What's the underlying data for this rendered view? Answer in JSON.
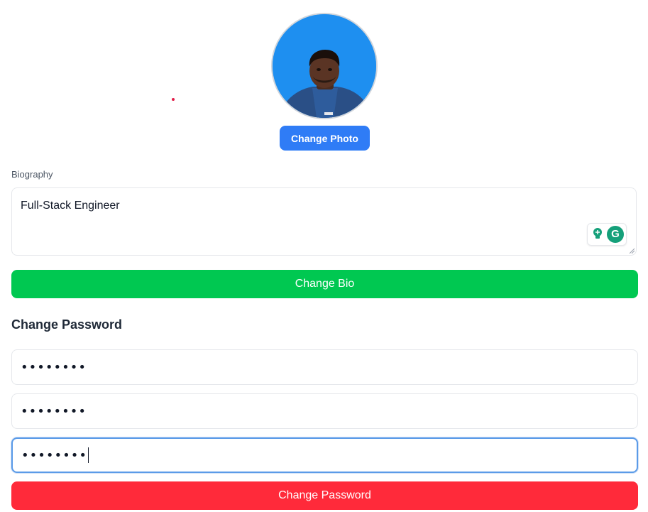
{
  "profile": {
    "change_photo_label": "Change Photo"
  },
  "biography": {
    "label": "Biography",
    "value": "Full-Stack Engineer",
    "change_bio_label": "Change Bio"
  },
  "password": {
    "section_title": "Change Password",
    "fields": [
      {
        "masked_value": "••••••••"
      },
      {
        "masked_value": "••••••••"
      },
      {
        "masked_value": "••••••••"
      }
    ],
    "change_password_label": "Change Password"
  },
  "colors": {
    "photo_button": "#2f7cf6",
    "bio_button": "#00c851",
    "password_button": "#ff2a3a",
    "avatar_background": "#1e8ff0",
    "focus_border": "#5b9be8"
  },
  "icons": {
    "grammarly_bulb": "lightbulb-icon",
    "grammarly_logo": "grammarly-g-icon"
  }
}
